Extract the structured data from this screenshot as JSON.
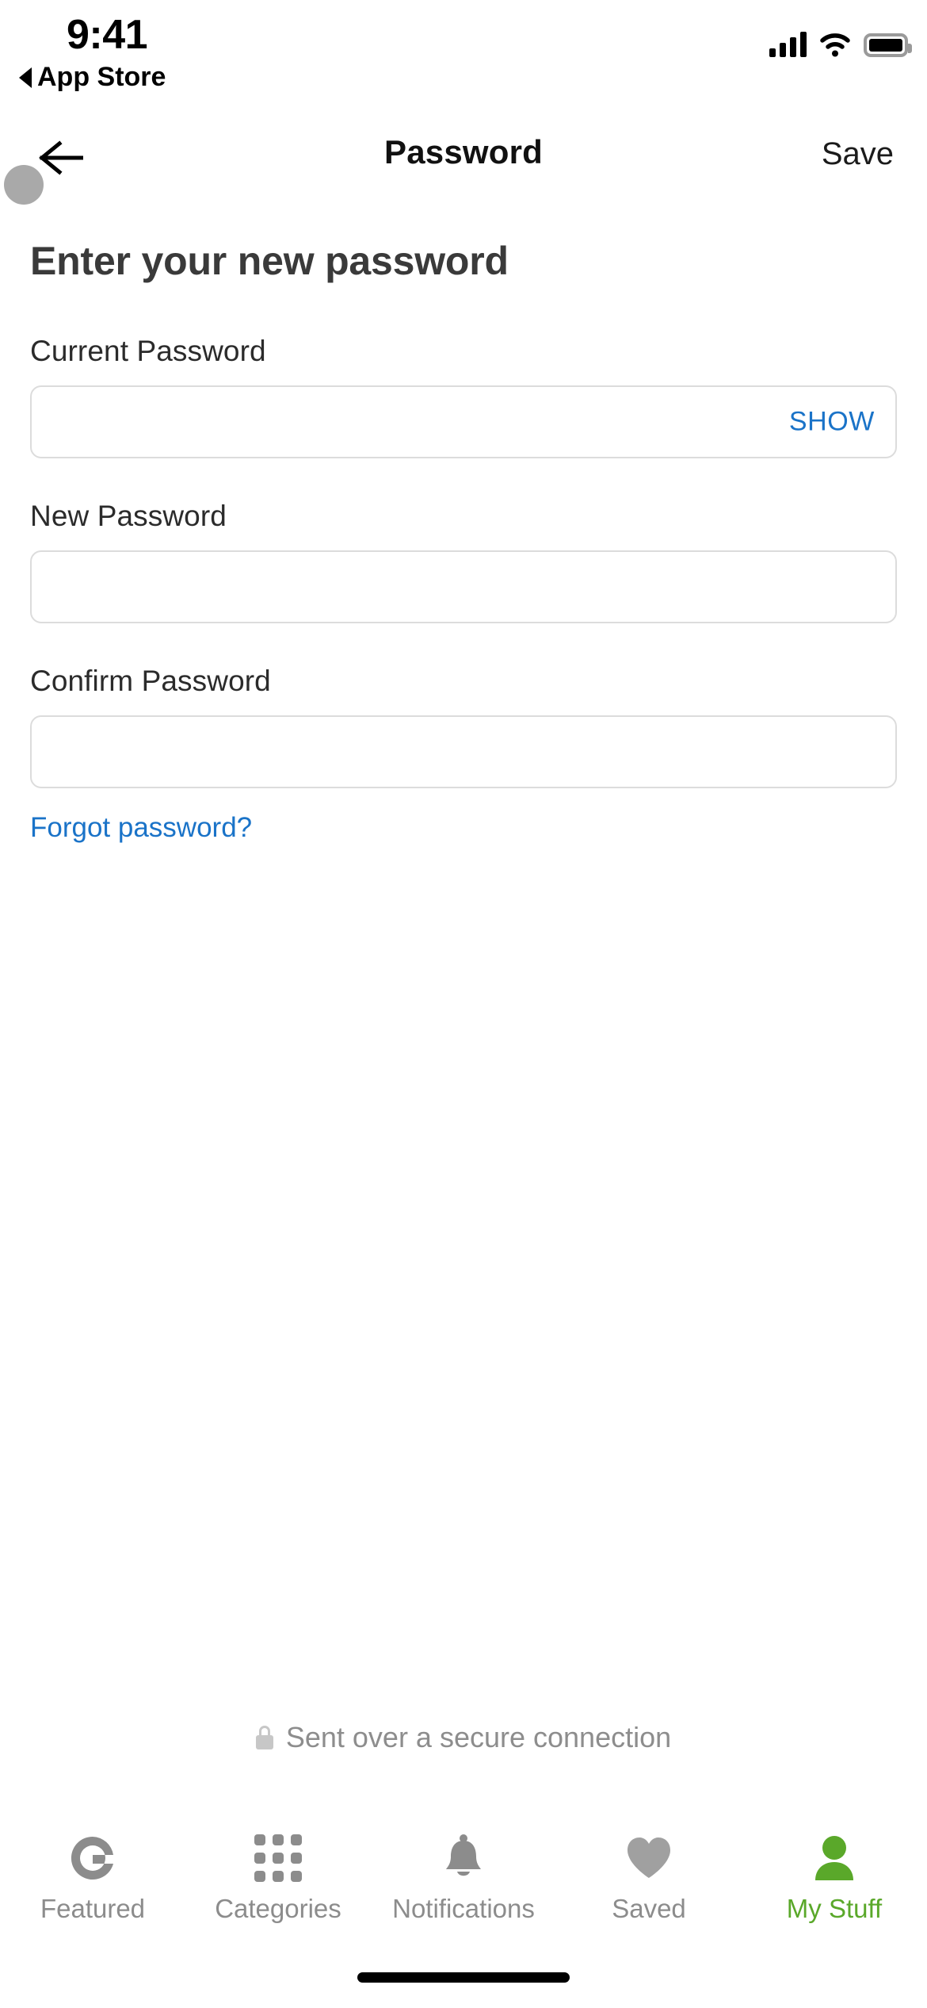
{
  "status_bar": {
    "time": "9:41",
    "back_app_label": "App Store",
    "signal_icon": "cellular-signal-icon",
    "wifi_icon": "wifi-icon",
    "battery_icon": "battery-icon"
  },
  "nav_bar": {
    "back_icon": "back-arrow-icon",
    "title": "Password",
    "save_label": "Save"
  },
  "main": {
    "heading": "Enter your new password",
    "fields": [
      {
        "label": "Current Password",
        "value": "",
        "placeholder": "",
        "show_label": "SHOW",
        "has_show": true
      },
      {
        "label": "New Password",
        "value": "",
        "placeholder": "",
        "show_label": "",
        "has_show": false
      },
      {
        "label": "Confirm Password",
        "value": "",
        "placeholder": "",
        "show_label": "",
        "has_show": false
      }
    ],
    "forgot_label": "Forgot password?"
  },
  "secure_note": {
    "icon": "lock-icon",
    "text": "Sent over a secure connection"
  },
  "tab_bar": {
    "items": [
      {
        "label": "Featured",
        "icon": "g-logo-icon",
        "active": false
      },
      {
        "label": "Categories",
        "icon": "grid-icon",
        "active": false
      },
      {
        "label": "Notifications",
        "icon": "bell-icon",
        "active": false
      },
      {
        "label": "Saved",
        "icon": "heart-icon",
        "active": false
      },
      {
        "label": "My Stuff",
        "icon": "person-icon",
        "active": true
      }
    ]
  },
  "colors": {
    "link_blue": "#1a73c8",
    "accent_green": "#5aa82a",
    "inactive_gray": "#8c8c8c",
    "border_gray": "#dcdcdc",
    "heading_gray": "#3a3a3a"
  }
}
